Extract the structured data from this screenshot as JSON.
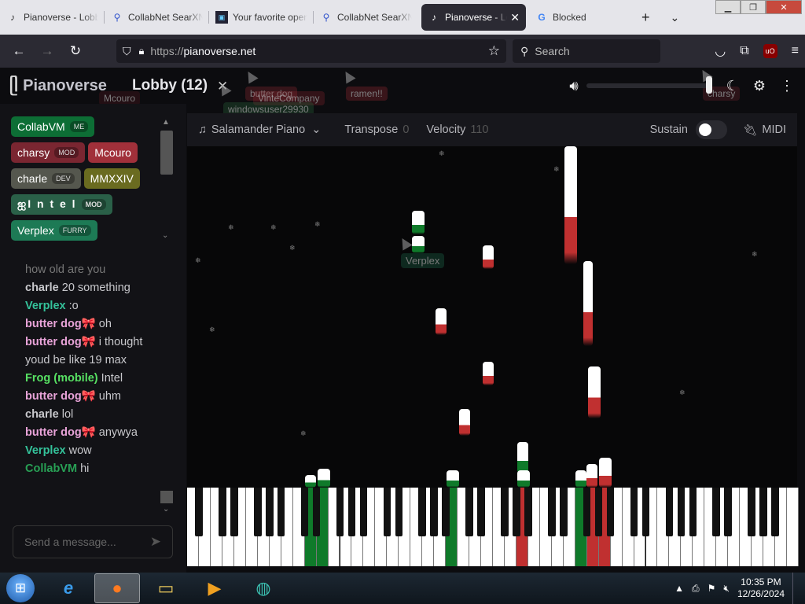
{
  "browser": {
    "tabs": [
      {
        "title": "Pianoverse - Lobby",
        "icon": "pianoverse-icon"
      },
      {
        "title": "CollabNet SearXNG",
        "icon": "searx-icon"
      },
      {
        "title": "Your favorite open",
        "icon": "monitor-icon"
      },
      {
        "title": "CollabNet SearXNG",
        "icon": "searx-icon"
      },
      {
        "title": "Pianoverse - Lobby",
        "icon": "pianoverse-icon",
        "active": true
      },
      {
        "title": "Blocked",
        "icon": "google-icon"
      }
    ],
    "new_tab": "+",
    "tab_list": "⌄",
    "url_prefix": "https://",
    "url": "pianoverse.net",
    "search_placeholder": "Search"
  },
  "app": {
    "logo": "Pianoverse",
    "lobby": "Lobby (12)",
    "lobby_close": "✕",
    "ghost_labels": [
      "Mcouro",
      "butter dog",
      "VinteCompany",
      "windowsuser29930",
      "ramen!!",
      "charsy",
      "Verplex"
    ]
  },
  "users": [
    {
      "name": "CollabVM",
      "badge": "ME",
      "color": "#0d6e35"
    },
    {
      "name": "charsy",
      "badge": "MOD",
      "color": "#7a2631"
    },
    {
      "name": "Mcouro",
      "badge": "",
      "color": "#a1303a"
    },
    {
      "name": "charle",
      "badge": "DEV",
      "color": "#55574e"
    },
    {
      "name": "MMXXIV",
      "badge": "",
      "color": "#6a6b20"
    },
    {
      "name": "ஐI n t e l",
      "badge": "MOD",
      "color": "#2a6048"
    },
    {
      "name": "Verplex",
      "badge": "FURRY",
      "color": "#1d7a55"
    }
  ],
  "chat": [
    {
      "name": "",
      "text": "how old are you",
      "color": "#c8c8cc"
    },
    {
      "name": "charle",
      "text": "20 something",
      "color": "#c8c8cc"
    },
    {
      "name": "Verplex",
      "text": ":o",
      "color": "#34c29a"
    },
    {
      "name": "butter dog🎀",
      "text": "oh",
      "color": "#e8a3d8"
    },
    {
      "name": "butter dog🎀",
      "text": "i thought youd be like 19 max",
      "color": "#e8a3d8"
    },
    {
      "name": "Frog (mobile)",
      "text": "Intel",
      "color": "#57e063"
    },
    {
      "name": "butter dog🎀",
      "text": "uhm",
      "color": "#e8a3d8"
    },
    {
      "name": "charle",
      "text": "lol",
      "color": "#c8c8cc"
    },
    {
      "name": "butter dog🎀",
      "text": "anywya",
      "color": "#e8a3d8"
    },
    {
      "name": "Verplex",
      "text": "wow",
      "color": "#34c29a"
    },
    {
      "name": "CollabVM",
      "text": "hi",
      "color": "#28a055"
    }
  ],
  "message_placeholder": "Send a message...",
  "controls": {
    "instrument": "Salamander Piano",
    "transpose_label": "Transpose",
    "transpose_value": "0",
    "velocity_label": "Velocity",
    "velocity_value": "110",
    "sustain_label": "Sustain",
    "midi_label": "MIDI"
  },
  "colors": {
    "green": "#0f7a2a",
    "red": "#c03030",
    "bg": "#0c0c0f"
  },
  "taskbar": {
    "time": "10:35 PM",
    "date": "12/26/2024",
    "apps": [
      "ie-icon",
      "firefox-icon",
      "explorer-icon",
      "media-player-icon",
      "network-icon"
    ]
  }
}
